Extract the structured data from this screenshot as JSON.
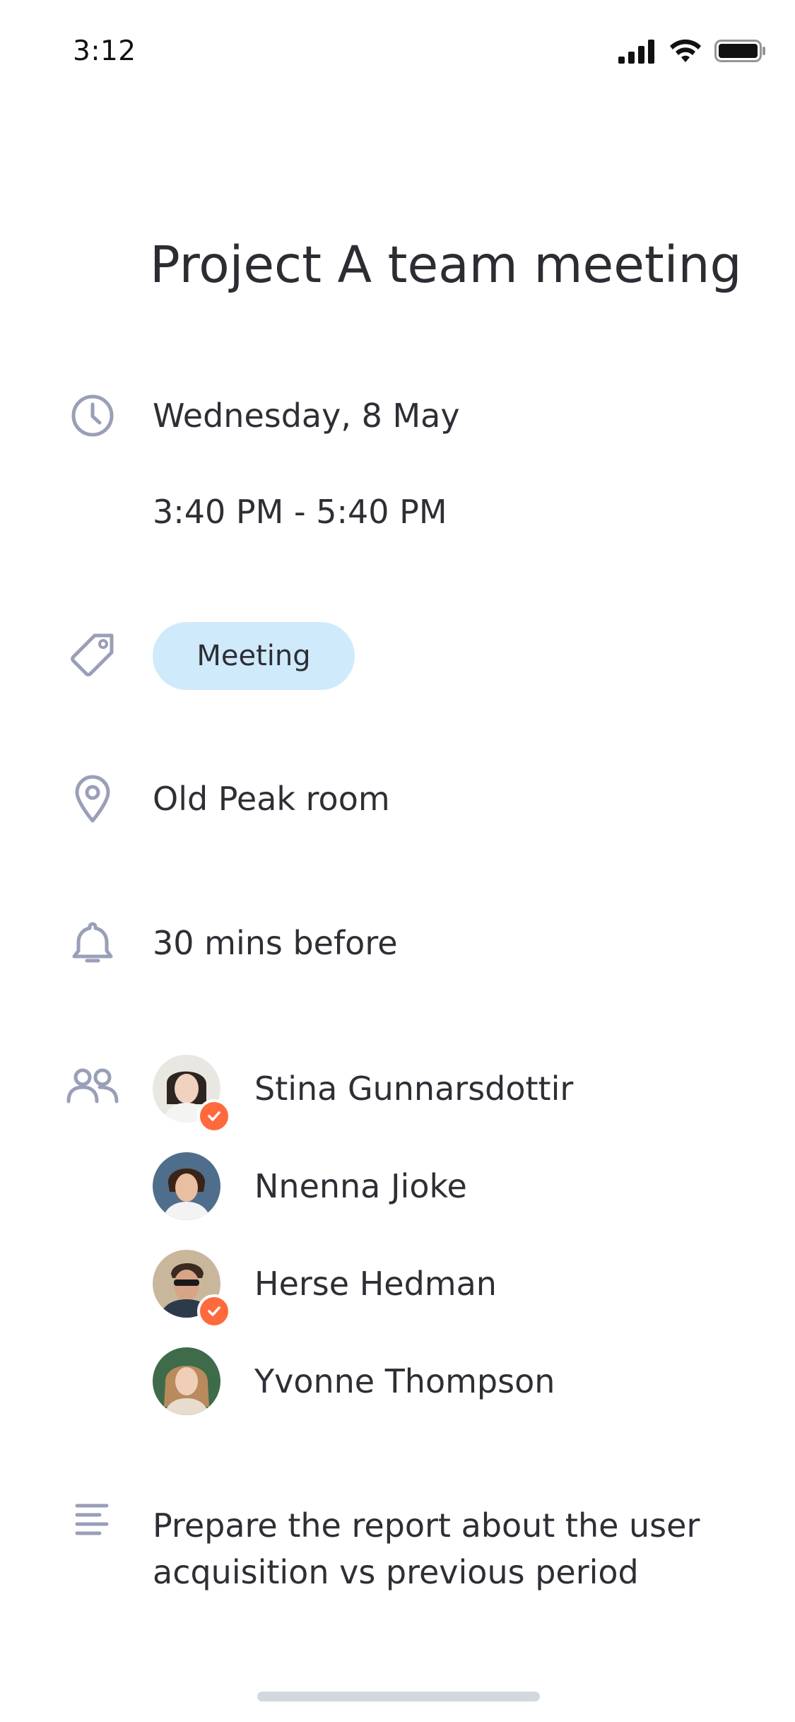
{
  "status_bar": {
    "time": "3:12",
    "icons": [
      "signal-icon",
      "wifi-icon",
      "battery-icon"
    ]
  },
  "event": {
    "title": "Project A team meeting",
    "date": "Wednesday, 8 May",
    "time_range": "3:40 PM - 5:40 PM",
    "tag": "Meeting",
    "location": "Old Peak room",
    "reminder": "30 mins before",
    "participants": [
      {
        "name": "Stina Gunnarsdottir",
        "accepted": true
      },
      {
        "name": "Nnenna Jioke",
        "accepted": false
      },
      {
        "name": "Herse Hedman",
        "accepted": true
      },
      {
        "name": "Yvonne Thompson",
        "accepted": false
      }
    ],
    "notes": "Prepare the report about the user acquisition vs previous period"
  },
  "colors": {
    "icon": "#9a9fb8",
    "tag_background": "#cfeafb",
    "badge": "#ff6a3d",
    "text": "#2d2f35"
  }
}
